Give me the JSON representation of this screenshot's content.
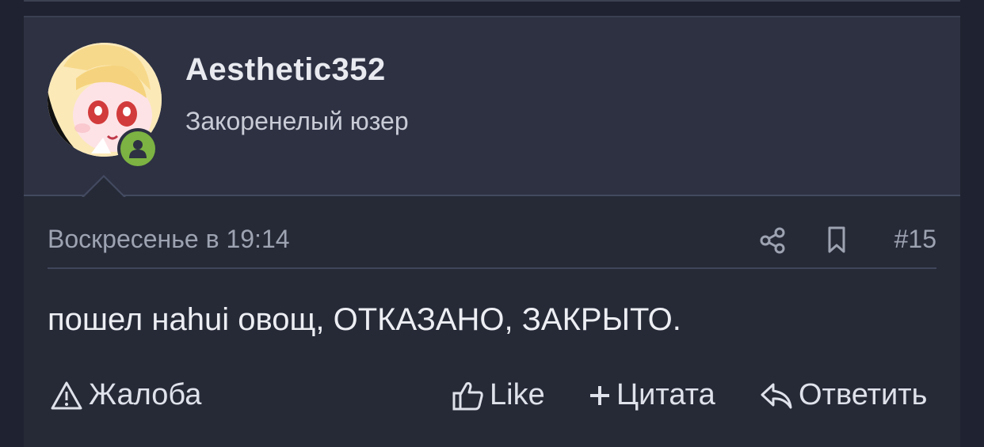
{
  "post": {
    "author": {
      "username": "Aesthetic352",
      "title": "Закоренелый юзер",
      "online": true
    },
    "timestamp": "Воскресенье в 19:14",
    "post_number": "#15",
    "message": "пошел наhui овощ, ОТКАЗАНО, ЗАКРЫТО.",
    "actions": {
      "report": "Жалоба",
      "like": "Like",
      "quote": "Цитата",
      "reply": "Ответить"
    }
  },
  "icons": {
    "share": "share-icon",
    "bookmark": "bookmark-icon",
    "report": "warning-icon",
    "like": "thumbs-up-icon",
    "quote": "plus-icon",
    "reply": "reply-icon",
    "online": "user-icon"
  },
  "colors": {
    "background": "#1f2230",
    "header": "#2d3142",
    "body": "#262a37",
    "online_badge": "#7cb342",
    "text_muted": "#9ea3b2"
  }
}
